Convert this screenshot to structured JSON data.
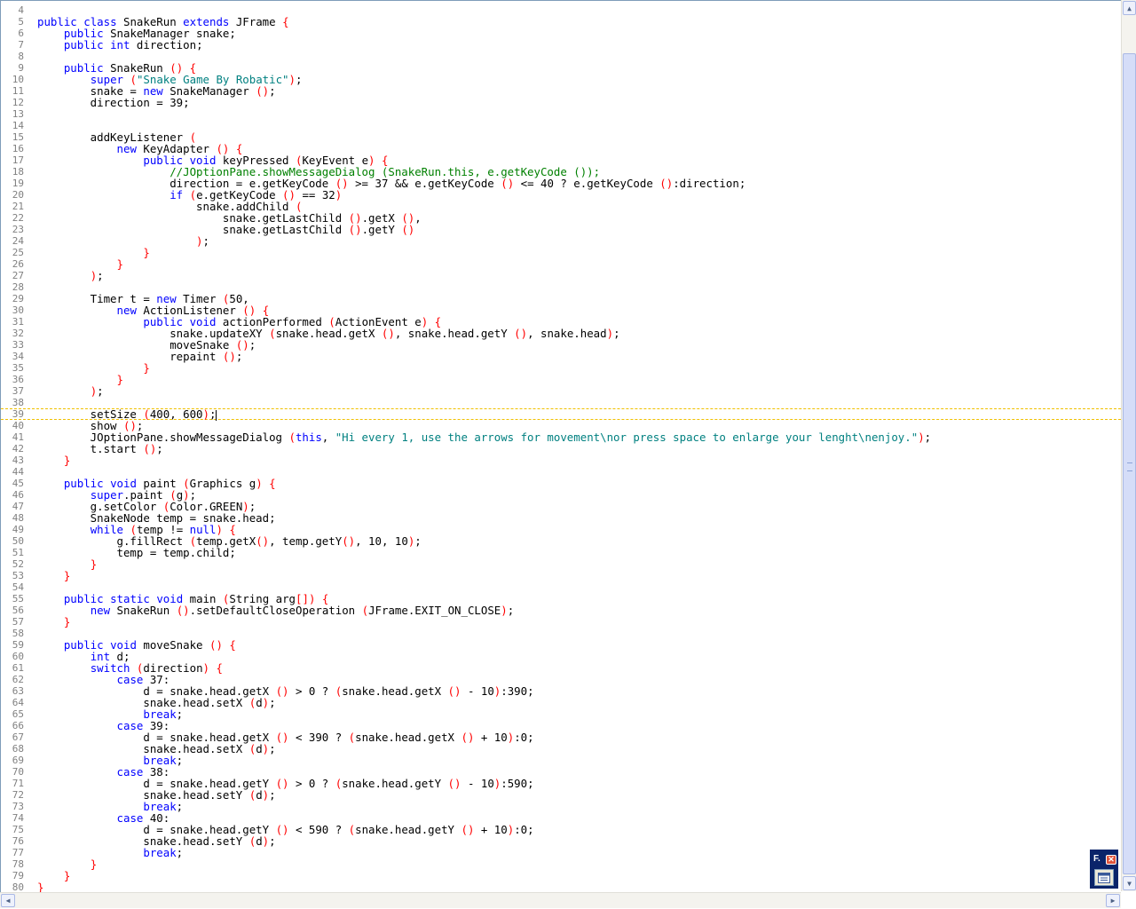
{
  "editor": {
    "cursor_line": 39,
    "lines": [
      {
        "n": "4",
        "html": ""
      },
      {
        "n": "5",
        "html": "<span class=\"kw\">public</span> <span class=\"kw\">class</span> SnakeRun <span class=\"kw\">extends</span> JFrame <span class=\"p\">{</span>"
      },
      {
        "n": "6",
        "html": "    <span class=\"kw\">public</span> SnakeManager snake;"
      },
      {
        "n": "7",
        "html": "    <span class=\"kw\">public</span> <span class=\"kw\">int</span> direction;"
      },
      {
        "n": "8",
        "html": ""
      },
      {
        "n": "9",
        "html": "    <span class=\"kw\">public</span> SnakeRun <span class=\"p\">(</span><span class=\"p\">)</span> <span class=\"p\">{</span>"
      },
      {
        "n": "10",
        "html": "        <span class=\"kw\">super</span> <span class=\"p\">(</span><span class=\"str\">\"Snake Game By Robatic\"</span><span class=\"p\">)</span>;"
      },
      {
        "n": "11",
        "html": "        snake = <span class=\"kw\">new</span> SnakeManager <span class=\"p\">(</span><span class=\"p\">)</span>;"
      },
      {
        "n": "12",
        "html": "        direction = 39;"
      },
      {
        "n": "13",
        "html": ""
      },
      {
        "n": "14",
        "html": ""
      },
      {
        "n": "15",
        "html": "        addKeyListener <span class=\"p\">(</span>"
      },
      {
        "n": "16",
        "html": "            <span class=\"kw\">new</span> KeyAdapter <span class=\"p\">(</span><span class=\"p\">)</span> <span class=\"p\">{</span>"
      },
      {
        "n": "17",
        "html": "                <span class=\"kw\">public</span> <span class=\"kw\">void</span> keyPressed <span class=\"p\">(</span>KeyEvent e<span class=\"p\">)</span> <span class=\"p\">{</span>"
      },
      {
        "n": "18",
        "html": "                    <span class=\"cmt\">//JOptionPane.showMessageDialog (SnakeRun.this, e.getKeyCode ());</span>"
      },
      {
        "n": "19",
        "html": "                    direction = e.getKeyCode <span class=\"p\">(</span><span class=\"p\">)</span> &gt;= 37 &amp;&amp; e.getKeyCode <span class=\"p\">(</span><span class=\"p\">)</span> &lt;= 40 ? e.getKeyCode <span class=\"p\">(</span><span class=\"p\">)</span>:direction;"
      },
      {
        "n": "20",
        "html": "                    <span class=\"kw\">if</span> <span class=\"p\">(</span>e.getKeyCode <span class=\"p\">(</span><span class=\"p\">)</span> == 32<span class=\"p\">)</span>"
      },
      {
        "n": "21",
        "html": "                        snake.addChild <span class=\"p\">(</span>"
      },
      {
        "n": "22",
        "html": "                            snake.getLastChild <span class=\"p\">(</span><span class=\"p\">)</span>.getX <span class=\"p\">(</span><span class=\"p\">)</span>,"
      },
      {
        "n": "23",
        "html": "                            snake.getLastChild <span class=\"p\">(</span><span class=\"p\">)</span>.getY <span class=\"p\">(</span><span class=\"p\">)</span>"
      },
      {
        "n": "24",
        "html": "                        <span class=\"p\">)</span>;"
      },
      {
        "n": "25",
        "html": "                <span class=\"p\">}</span>"
      },
      {
        "n": "26",
        "html": "            <span class=\"p\">}</span>"
      },
      {
        "n": "27",
        "html": "        <span class=\"p\">)</span>;"
      },
      {
        "n": "28",
        "html": ""
      },
      {
        "n": "29",
        "html": "        Timer t = <span class=\"kw\">new</span> Timer <span class=\"p\">(</span>50,"
      },
      {
        "n": "30",
        "html": "            <span class=\"kw\">new</span> ActionListener <span class=\"p\">(</span><span class=\"p\">)</span> <span class=\"p\">{</span>"
      },
      {
        "n": "31",
        "html": "                <span class=\"kw\">public</span> <span class=\"kw\">void</span> actionPerformed <span class=\"p\">(</span>ActionEvent e<span class=\"p\">)</span> <span class=\"p\">{</span>"
      },
      {
        "n": "32",
        "html": "                    snake.updateXY <span class=\"p\">(</span>snake.head.getX <span class=\"p\">(</span><span class=\"p\">)</span>, snake.head.getY <span class=\"p\">(</span><span class=\"p\">)</span>, snake.head<span class=\"p\">)</span>;"
      },
      {
        "n": "33",
        "html": "                    moveSnake <span class=\"p\">(</span><span class=\"p\">)</span>;"
      },
      {
        "n": "34",
        "html": "                    repaint <span class=\"p\">(</span><span class=\"p\">)</span>;"
      },
      {
        "n": "35",
        "html": "                <span class=\"p\">}</span>"
      },
      {
        "n": "36",
        "html": "            <span class=\"p\">}</span>"
      },
      {
        "n": "37",
        "html": "        <span class=\"p\">)</span>;"
      },
      {
        "n": "38",
        "html": ""
      },
      {
        "n": "39",
        "html": "        setSize <span class=\"p\">(</span>400, 600<span class=\"p\">)</span>;<span class=\"cursor\"></span>"
      },
      {
        "n": "40",
        "html": "        show <span class=\"p\">(</span><span class=\"p\">)</span>;"
      },
      {
        "n": "41",
        "html": "        JOptionPane.showMessageDialog <span class=\"p\">(</span><span class=\"kw\">this</span>, <span class=\"str\">\"Hi every 1, use the arrows for movement\\nor press space to enlarge your lenght\\nenjoy.\"</span><span class=\"p\">)</span>;"
      },
      {
        "n": "42",
        "html": "        t.start <span class=\"p\">(</span><span class=\"p\">)</span>;"
      },
      {
        "n": "43",
        "html": "    <span class=\"p\">}</span>"
      },
      {
        "n": "44",
        "html": ""
      },
      {
        "n": "45",
        "html": "    <span class=\"kw\">public</span> <span class=\"kw\">void</span> paint <span class=\"p\">(</span>Graphics g<span class=\"p\">)</span> <span class=\"p\">{</span>"
      },
      {
        "n": "46",
        "html": "        <span class=\"kw\">super</span>.paint <span class=\"p\">(</span>g<span class=\"p\">)</span>;"
      },
      {
        "n": "47",
        "html": "        g.setColor <span class=\"p\">(</span>Color.GREEN<span class=\"p\">)</span>;"
      },
      {
        "n": "48",
        "html": "        SnakeNode temp = snake.head;"
      },
      {
        "n": "49",
        "html": "        <span class=\"kw\">while</span> <span class=\"p\">(</span>temp != <span class=\"kw\">null</span><span class=\"p\">)</span> <span class=\"p\">{</span>"
      },
      {
        "n": "50",
        "html": "            g.fillRect <span class=\"p\">(</span>temp.getX<span class=\"p\">(</span><span class=\"p\">)</span>, temp.getY<span class=\"p\">(</span><span class=\"p\">)</span>, 10, 10<span class=\"p\">)</span>;"
      },
      {
        "n": "51",
        "html": "            temp = temp.child;"
      },
      {
        "n": "52",
        "html": "        <span class=\"p\">}</span>"
      },
      {
        "n": "53",
        "html": "    <span class=\"p\">}</span>"
      },
      {
        "n": "54",
        "html": ""
      },
      {
        "n": "55",
        "html": "    <span class=\"kw\">public</span> <span class=\"kw\">static</span> <span class=\"kw\">void</span> main <span class=\"p\">(</span>String arg<span class=\"p\">[</span><span class=\"p\">]</span><span class=\"p\">)</span> <span class=\"p\">{</span>"
      },
      {
        "n": "56",
        "html": "        <span class=\"kw\">new</span> SnakeRun <span class=\"p\">(</span><span class=\"p\">)</span>.setDefaultCloseOperation <span class=\"p\">(</span>JFrame.EXIT_ON_CLOSE<span class=\"p\">)</span>;"
      },
      {
        "n": "57",
        "html": "    <span class=\"p\">}</span>"
      },
      {
        "n": "58",
        "html": ""
      },
      {
        "n": "59",
        "html": "    <span class=\"kw\">public</span> <span class=\"kw\">void</span> moveSnake <span class=\"p\">(</span><span class=\"p\">)</span> <span class=\"p\">{</span>"
      },
      {
        "n": "60",
        "html": "        <span class=\"kw\">int</span> d;"
      },
      {
        "n": "61",
        "html": "        <span class=\"kw\">switch</span> <span class=\"p\">(</span>direction<span class=\"p\">)</span> <span class=\"p\">{</span>"
      },
      {
        "n": "62",
        "html": "            <span class=\"kw\">case</span> 37:"
      },
      {
        "n": "63",
        "html": "                d = snake.head.getX <span class=\"p\">(</span><span class=\"p\">)</span> &gt; 0 ? <span class=\"p\">(</span>snake.head.getX <span class=\"p\">(</span><span class=\"p\">)</span> - 10<span class=\"p\">)</span>:390;"
      },
      {
        "n": "64",
        "html": "                snake.head.setX <span class=\"p\">(</span>d<span class=\"p\">)</span>;"
      },
      {
        "n": "65",
        "html": "                <span class=\"kw\">break</span>;"
      },
      {
        "n": "66",
        "html": "            <span class=\"kw\">case</span> 39:"
      },
      {
        "n": "67",
        "html": "                d = snake.head.getX <span class=\"p\">(</span><span class=\"p\">)</span> &lt; 390 ? <span class=\"p\">(</span>snake.head.getX <span class=\"p\">(</span><span class=\"p\">)</span> + 10<span class=\"p\">)</span>:0;"
      },
      {
        "n": "68",
        "html": "                snake.head.setX <span class=\"p\">(</span>d<span class=\"p\">)</span>;"
      },
      {
        "n": "69",
        "html": "                <span class=\"kw\">break</span>;"
      },
      {
        "n": "70",
        "html": "            <span class=\"kw\">case</span> 38:"
      },
      {
        "n": "71",
        "html": "                d = snake.head.getY <span class=\"p\">(</span><span class=\"p\">)</span> &gt; 0 ? <span class=\"p\">(</span>snake.head.getY <span class=\"p\">(</span><span class=\"p\">)</span> - 10<span class=\"p\">)</span>:590;"
      },
      {
        "n": "72",
        "html": "                snake.head.setY <span class=\"p\">(</span>d<span class=\"p\">)</span>;"
      },
      {
        "n": "73",
        "html": "                <span class=\"kw\">break</span>;"
      },
      {
        "n": "74",
        "html": "            <span class=\"kw\">case</span> 40:"
      },
      {
        "n": "75",
        "html": "                d = snake.head.getY <span class=\"p\">(</span><span class=\"p\">)</span> &lt; 590 ? <span class=\"p\">(</span>snake.head.getY <span class=\"p\">(</span><span class=\"p\">)</span> + 10<span class=\"p\">)</span>:0;"
      },
      {
        "n": "76",
        "html": "                snake.head.setY <span class=\"p\">(</span>d<span class=\"p\">)</span>;"
      },
      {
        "n": "77",
        "html": "                <span class=\"kw\">break</span>;"
      },
      {
        "n": "78",
        "html": "        <span class=\"p\">}</span>"
      },
      {
        "n": "79",
        "html": "    <span class=\"p\">}</span>"
      },
      {
        "n": "80",
        "html": "<span class=\"p\">}</span>"
      }
    ]
  },
  "mini_window": {
    "title": "F.",
    "close_glyph": "✕",
    "icon": "list-icon"
  },
  "scrollbars": {
    "up_glyph": "▲",
    "down_glyph": "▼",
    "left_glyph": "◀",
    "right_glyph": "▶",
    "vertical_position": 0.06
  },
  "colors": {
    "keyword": "#0000ff",
    "string": "#008080",
    "comment": "#008000",
    "punctuation": "#ff0000",
    "line_number": "#808080",
    "current_line_border": "#f0c000"
  }
}
